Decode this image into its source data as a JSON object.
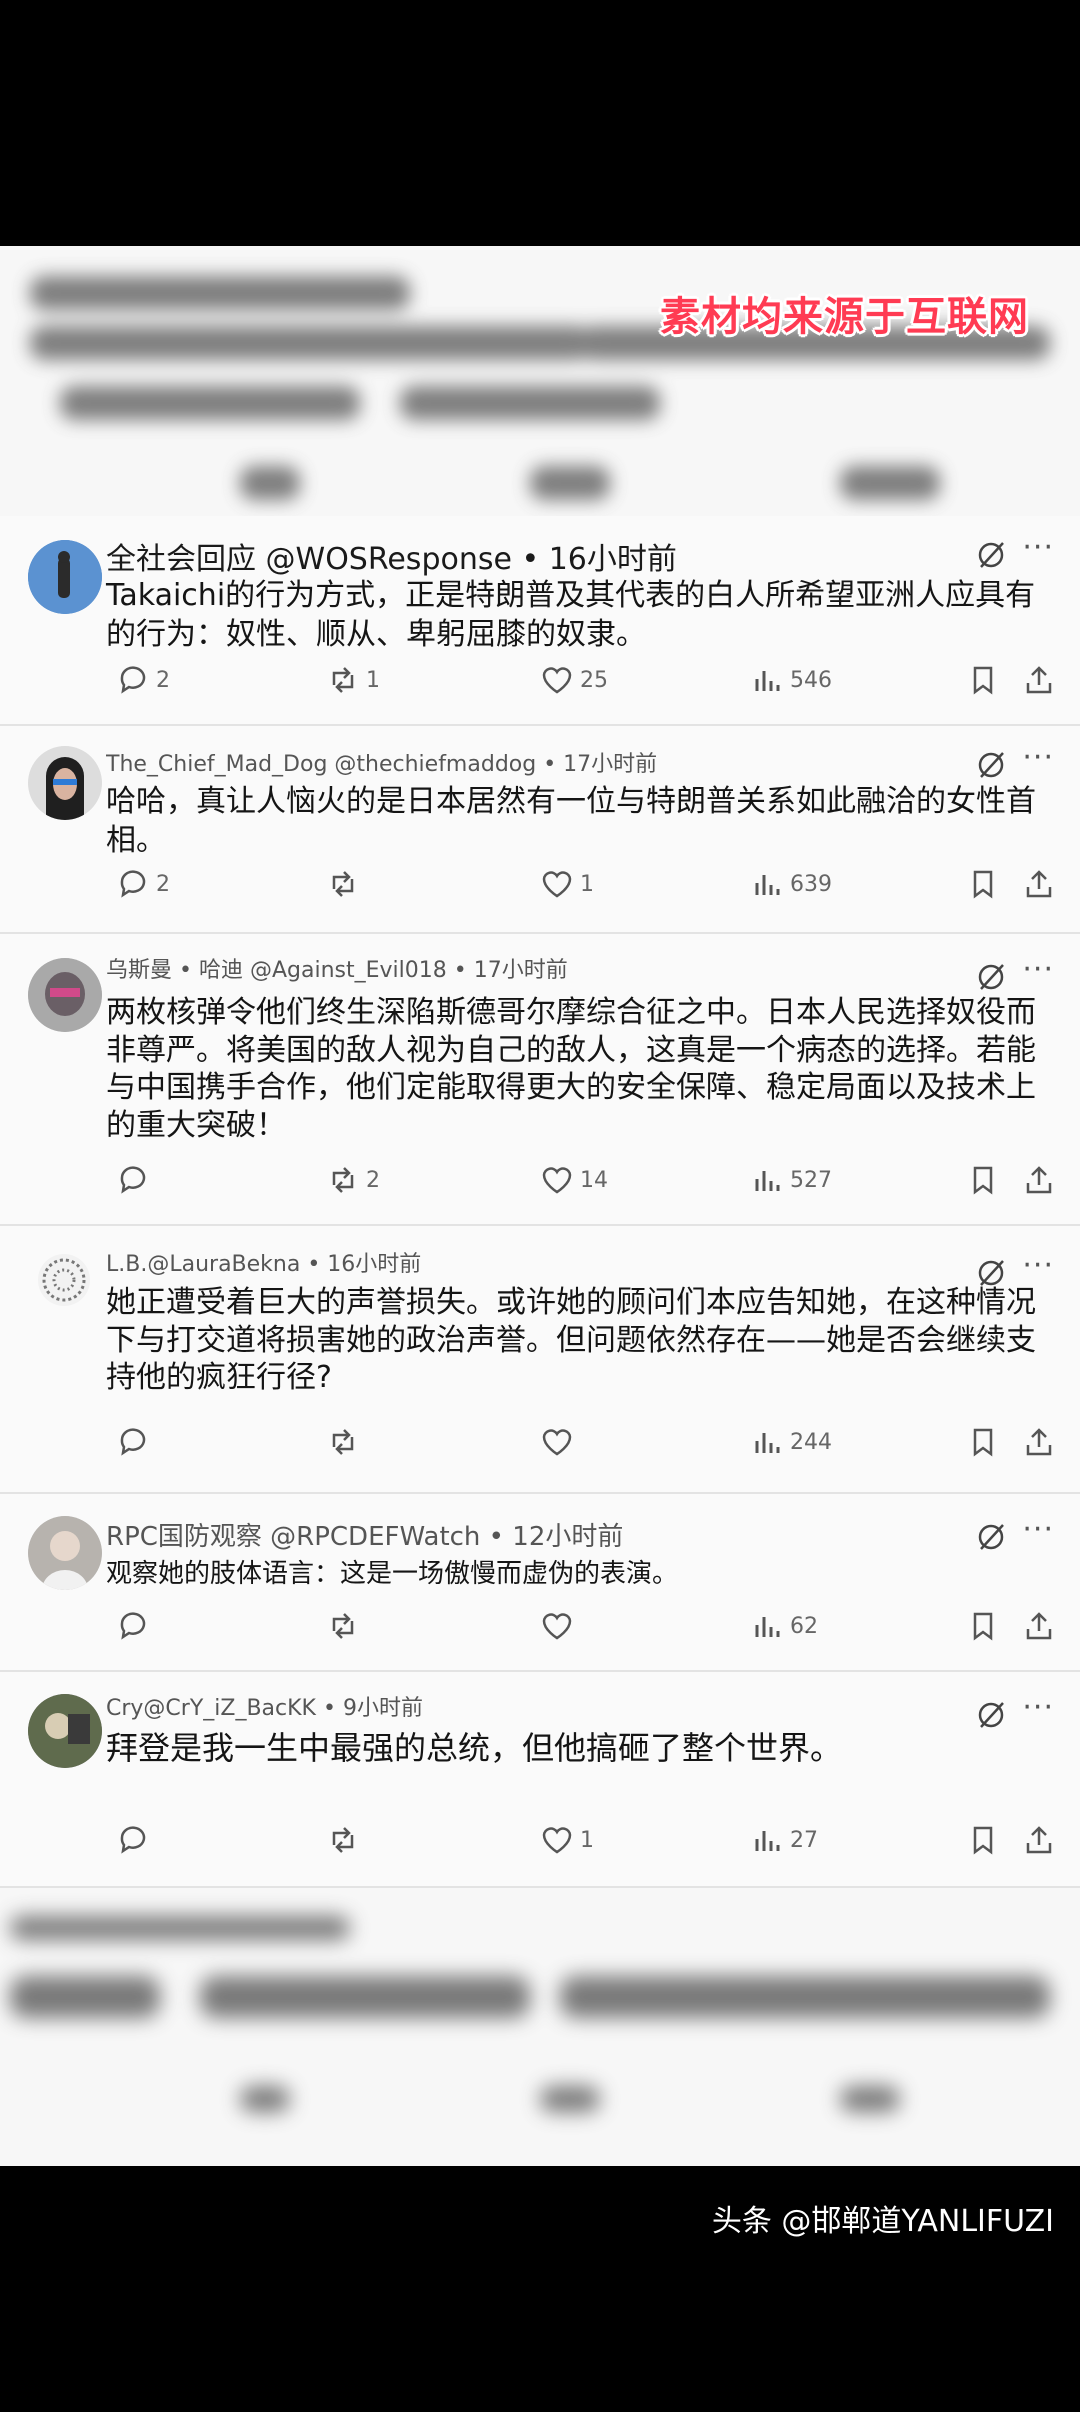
{
  "watermark": "素材均来源于互联网",
  "posts": [
    {
      "header": "全社会回应 @WOSResponse • 16小时前",
      "content": "Takaichi的行为方式，正是特朗普及其代表的白人所希望亚洲人应具有的行为：奴性、顺从、卑躬屈膝的奴隶。",
      "replies": "2",
      "reposts": "1",
      "likes": "25",
      "views": "546"
    },
    {
      "header": "The_Chief_Mad_Dog @thechiefmaddog • 17小时前",
      "content": "哈哈，真让人恼火的是日本居然有一位与特朗普关系如此融洽的女性首相。",
      "replies": "2",
      "reposts": "",
      "likes": "1",
      "views": "639"
    },
    {
      "header": "乌斯曼 • 哈迪 @Against_Evil018 • 17小时前",
      "content": "两枚核弹令他们终生深陷斯德哥尔摩综合征之中。日本人民选择奴役而非尊严。将美国的敌人视为自己的敌人，这真是一个病态的选择。若能与中国携手合作，他们定能取得更大的安全保障、稳定局面以及技术上的重大突破！",
      "replies": "",
      "reposts": "2",
      "likes": "14",
      "views": "527"
    },
    {
      "header": "L.B.@LauraBekna • 16小时前",
      "content": "她正遭受着巨大的声誉损失。或许她的顾问们本应告知她，在这种情况下与打交道将损害她的政治声誉。但问题依然存在——她是否会继续支持他的疯狂行径?",
      "replies": "",
      "reposts": "",
      "likes": "",
      "views": "244"
    },
    {
      "header": "RPC国防观察 @RPCDEFWatch • 12小时前",
      "content": "观察她的肢体语言：这是一场傲慢而虚伪的表演。",
      "replies": "",
      "reposts": "",
      "likes": "",
      "views": "62"
    },
    {
      "header": "Cry@CrY_iZ_BacKK • 9小时前",
      "content": "拜登是我一生中最强的总统，但他搞砸了整个世界。",
      "replies": "",
      "reposts": "",
      "likes": "1",
      "views": "27"
    }
  ],
  "footer": "头条 @邯郸道YANLIFUZI",
  "colors": {
    "watermark": "#ff3b53",
    "background": "#000000",
    "card": "#fafafa"
  }
}
